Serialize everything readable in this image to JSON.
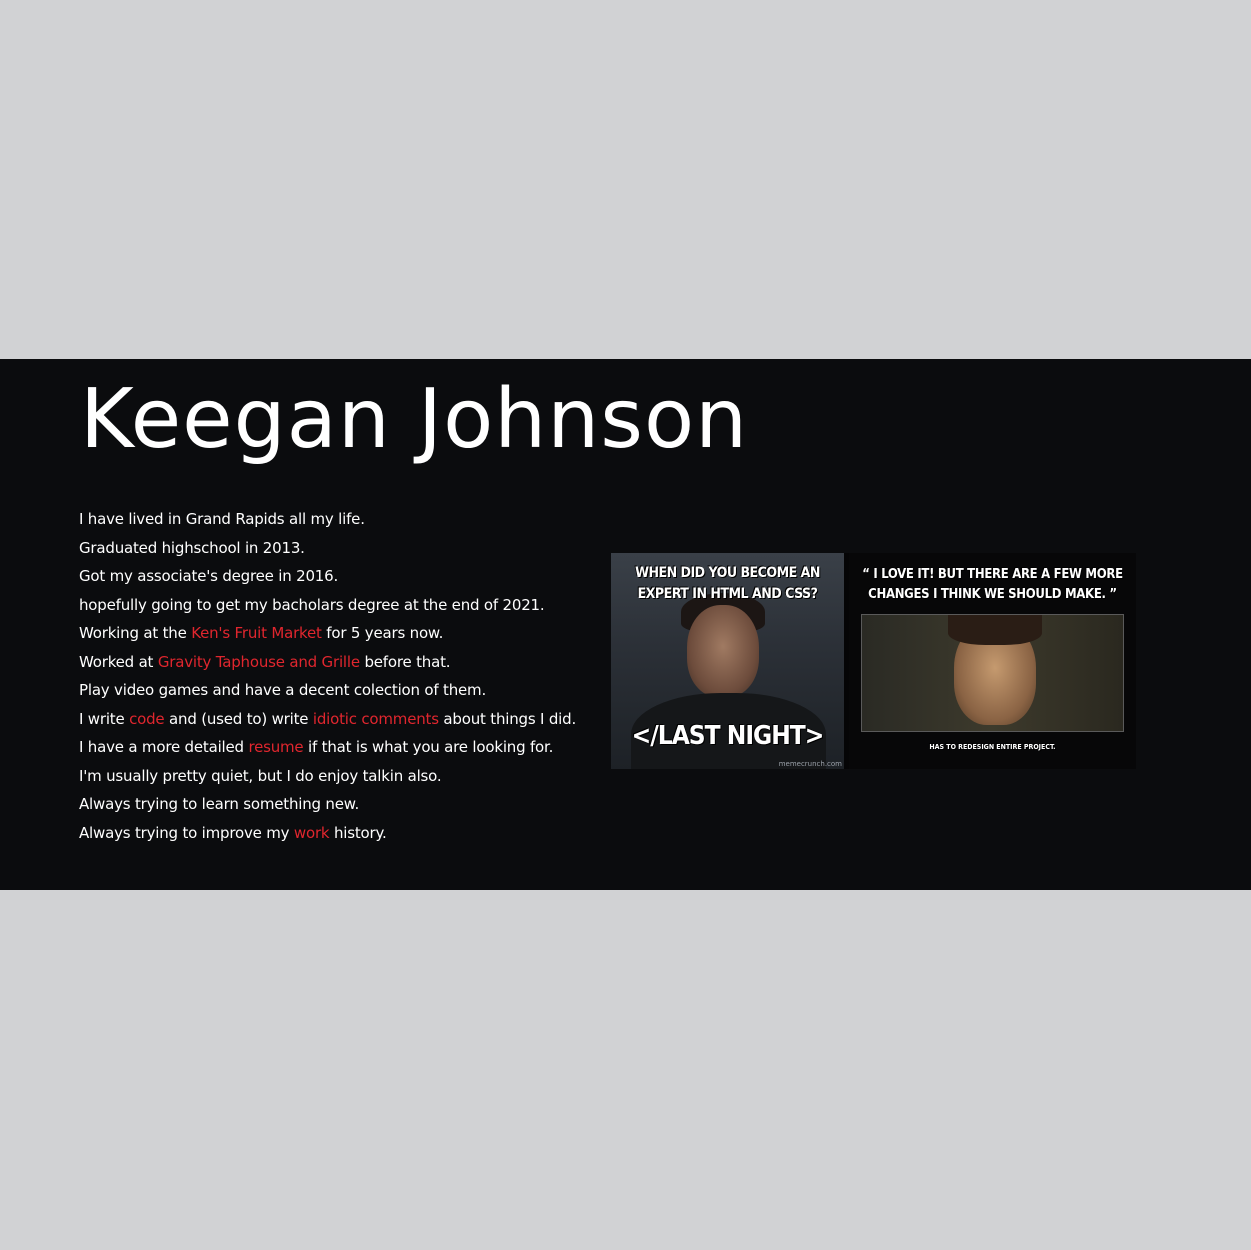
{
  "profile": {
    "name": "Keegan Johnson"
  },
  "bio": {
    "lines": [
      {
        "parts": [
          {
            "text": "I have lived in Grand Rapids all my life."
          }
        ]
      },
      {
        "parts": [
          {
            "text": "Graduated highschool in 2013."
          }
        ]
      },
      {
        "parts": [
          {
            "text": "Got my associate's degree in 2016."
          }
        ]
      },
      {
        "parts": [
          {
            "text": "hopefully going to get my bacholars degree at the end of 2021."
          }
        ]
      },
      {
        "parts": [
          {
            "text": "Working at the "
          },
          {
            "text": "Ken's Fruit Market",
            "link": true
          },
          {
            "text": " for 5 years now."
          }
        ]
      },
      {
        "parts": [
          {
            "text": "Worked at "
          },
          {
            "text": "Gravity Taphouse and Grille",
            "link": true
          },
          {
            "text": " before that."
          }
        ]
      },
      {
        "parts": [
          {
            "text": "Play video games and have a decent colection of them."
          }
        ]
      },
      {
        "parts": [
          {
            "text": "I write "
          },
          {
            "text": "code",
            "link": true
          },
          {
            "text": " and (used to) write "
          },
          {
            "text": "idiotic comments",
            "link": true
          },
          {
            "text": " about things I did."
          }
        ]
      },
      {
        "parts": [
          {
            "text": "I have a more detailed "
          },
          {
            "text": "resume",
            "link": true
          },
          {
            "text": " if that is what you are looking for."
          }
        ]
      },
      {
        "parts": [
          {
            "text": "I'm usually pretty quiet, but I do enjoy talkin also."
          }
        ]
      },
      {
        "parts": [
          {
            "text": "Always trying to learn something new."
          }
        ]
      },
      {
        "parts": [
          {
            "text": "Always trying to improve my "
          },
          {
            "text": "work",
            "link": true
          },
          {
            "text": " history."
          }
        ]
      }
    ]
  },
  "memes": {
    "meme1": {
      "top_text": "WHEN DID YOU BECOME AN EXPERT IN HTML AND CSS?",
      "bottom_text": "</LAST NIGHT>",
      "watermark": "memecrunch.com"
    },
    "meme2": {
      "top_text": "“ I LOVE IT! BUT THERE ARE A FEW MORE CHANGES I THINK WE SHOULD MAKE. ”",
      "bottom_text": "HAS TO REDESIGN ENTIRE PROJECT."
    }
  },
  "colors": {
    "page_background": "#d1d2d4",
    "band_background": "#0b0c0e",
    "text": "#ffffff",
    "link": "#e0262e"
  }
}
